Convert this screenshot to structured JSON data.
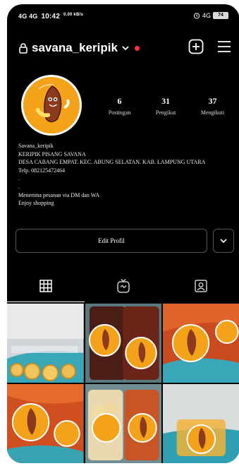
{
  "status_bar": {
    "network": "4G 4G",
    "time": "10:42",
    "speed": "0.00 kB/s",
    "right_network": "4G",
    "battery": "74"
  },
  "header": {
    "username": "savana_keripik",
    "lock_icon": "lock-icon",
    "add_icon": "plus-square-icon",
    "menu_icon": "hamburger-menu-icon"
  },
  "profile": {
    "stats": [
      {
        "value": "6",
        "label": "Postingan"
      },
      {
        "value": "31",
        "label": "Pengikut"
      },
      {
        "value": "37",
        "label": "Mengikuti"
      }
    ],
    "bio_lines": [
      "Savana_keripik",
      "KERIPIK PISANG SAVANA",
      "DESA CABANG EMPAT. KEC. ABUNG SELATAN. KAB. LAMPUNG UTARA",
      "Telp. 082125472464",
      ".",
      ".",
      "Menerima pesanan via DM dan WA",
      "Enjoy shopping"
    ],
    "edit_button": "Edit Profil"
  },
  "tabs": [
    {
      "icon": "grid-icon",
      "active": true
    },
    {
      "icon": "igtv-icon",
      "active": false
    },
    {
      "icon": "tagged-icon",
      "active": false
    }
  ],
  "colors": {
    "background": "#000000",
    "notification_dot": "#ff3040",
    "avatar_bg": "#f5a21b"
  }
}
